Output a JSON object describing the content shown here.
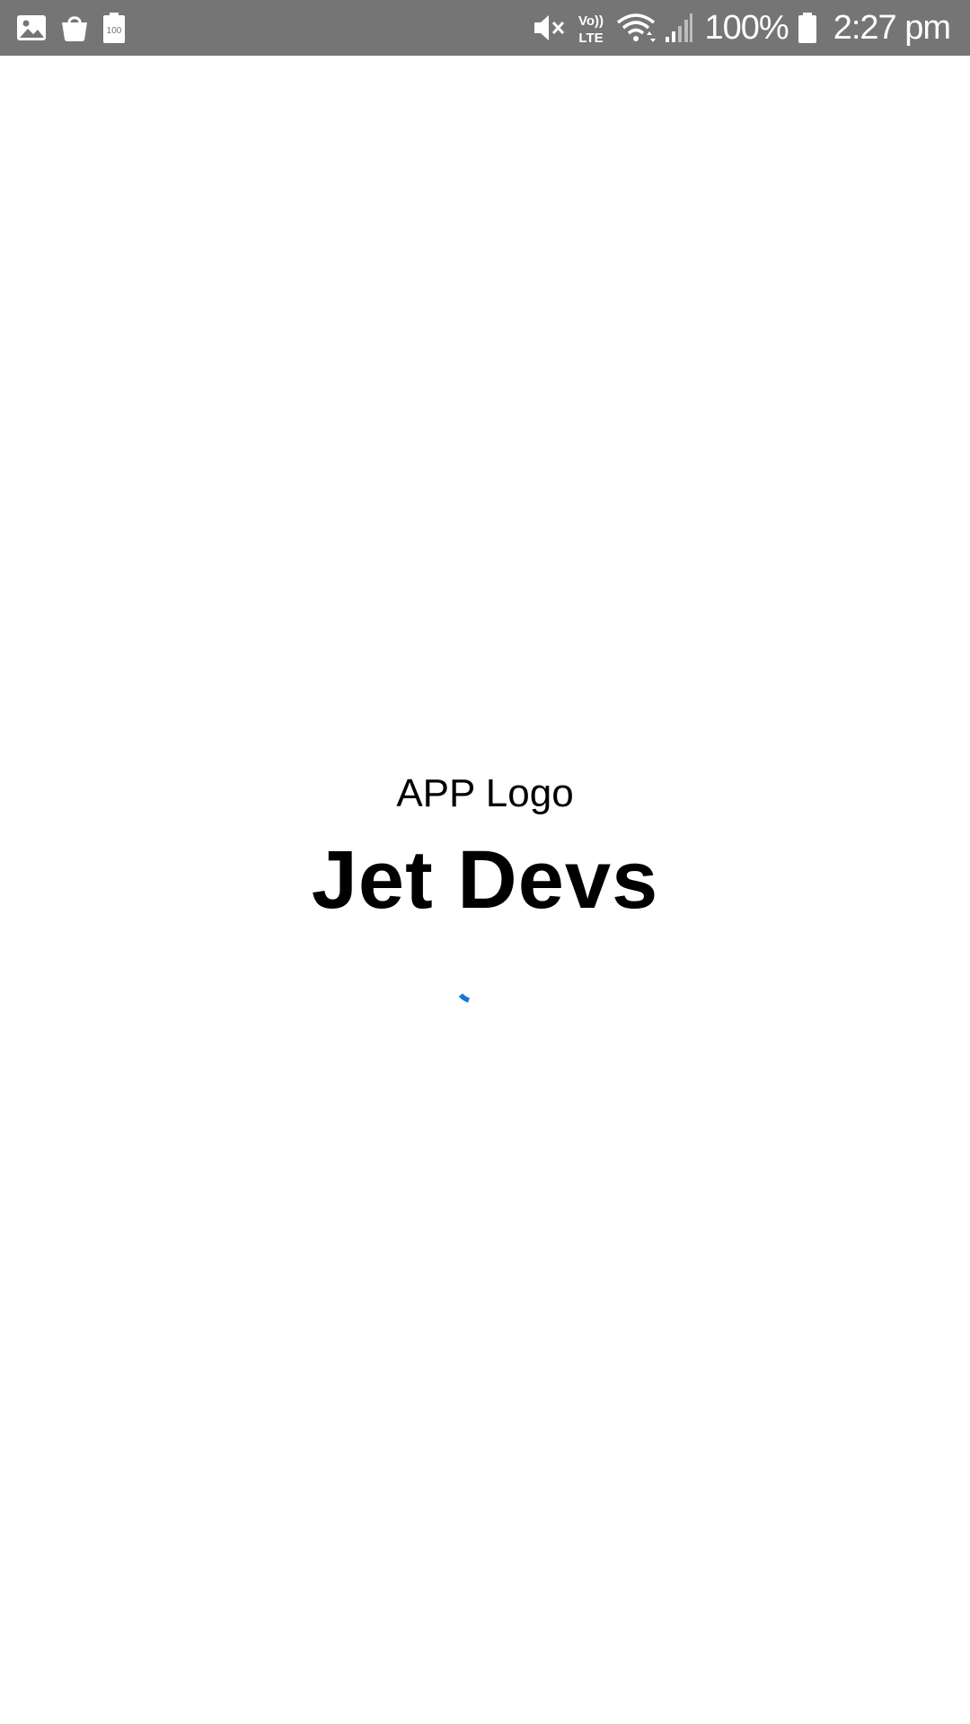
{
  "status_bar": {
    "left_icons": [
      "gallery-icon",
      "shopping-bag-icon",
      "battery-100-icon"
    ],
    "right_icons": [
      "mute-icon",
      "volte-icon",
      "wifi-icon",
      "signal-icon"
    ],
    "volte_label": "Vo)) LTE",
    "battery_percent": "100%",
    "time": "2:27 pm",
    "background_color": "#757575"
  },
  "splash": {
    "logo_label": "APP Logo",
    "app_name": "Jet Devs",
    "spinner_color": "#1976D2"
  }
}
